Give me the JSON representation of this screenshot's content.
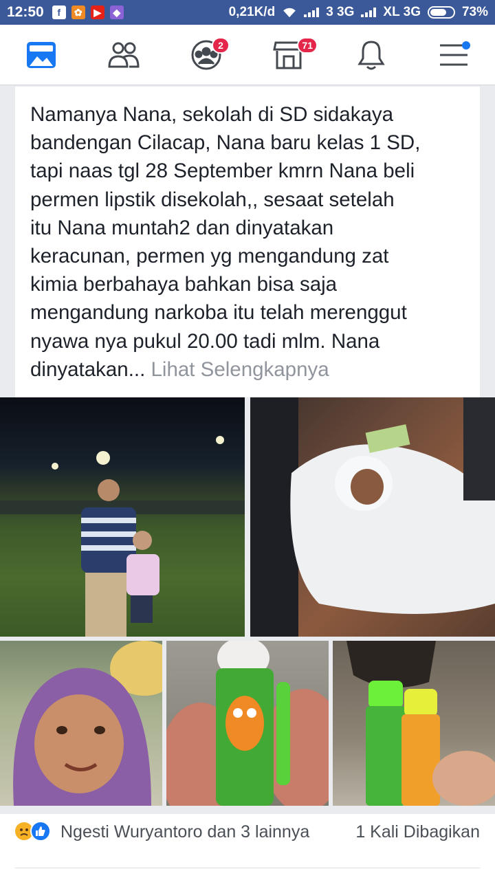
{
  "status_bar": {
    "time": "12:50",
    "network_speed": "0,21K/d",
    "carrier1": "3 3G",
    "carrier2": "XL 3G",
    "battery_percent": "73%",
    "battery_level": 0.73,
    "app_icons": [
      "facebook-icon",
      "app-icon-orange",
      "youtube-icon",
      "app-icon-purple"
    ]
  },
  "nav": {
    "items": [
      {
        "name": "news-feed",
        "icon": "news-feed-icon",
        "badge": ""
      },
      {
        "name": "friends",
        "icon": "friends-icon",
        "badge": ""
      },
      {
        "name": "groups",
        "icon": "groups-icon",
        "badge": "2"
      },
      {
        "name": "marketplace",
        "icon": "marketplace-icon",
        "badge": "71"
      },
      {
        "name": "notifications",
        "icon": "bell-icon",
        "badge": ""
      },
      {
        "name": "menu",
        "icon": "menu-icon",
        "badge": ""
      }
    ]
  },
  "post": {
    "lines": [
      "Namanya Nana, sekolah di SD sidakaya",
      "bandengan Cilacap, Nana baru kelas 1 SD,",
      "tapi naas tgl 28 September kmrn Nana beli",
      "permen lipstik disekolah,, sesaat setelah",
      "itu Nana muntah2 dan dinyatakan",
      "keracunan, permen yg mengandung zat",
      "kimia berbahaya bahkan bisa saja",
      "mengandung narkoba itu telah merenggut",
      "nyawa nya pukul 20.00 tadi mlm. Nana"
    ],
    "last_line": "dinyatakan...",
    "see_more": "Lihat Selengkapnya"
  },
  "reactions": {
    "icons": [
      "sad-reaction-icon",
      "like-reaction-icon"
    ],
    "names": "Ngesti Wuryantoro dan 3 lainnya",
    "shares": "1 Kali Dibagikan"
  },
  "colors": {
    "brand": "#3b5998",
    "badge": "#e4264b",
    "text": "#1d2129",
    "muted": "#90949c"
  }
}
